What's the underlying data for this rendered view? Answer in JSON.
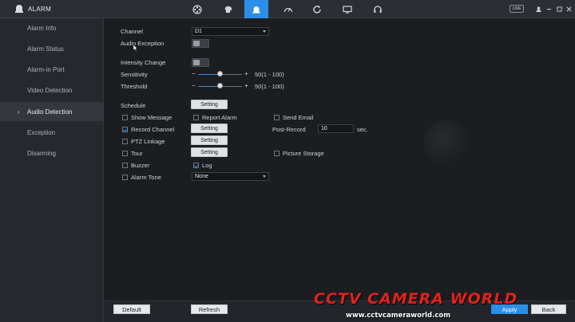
{
  "header": {
    "title": "ALARM",
    "live_label": "LIVE",
    "nav_icons": [
      "camera-icon",
      "brain-icon",
      "alarm-icon",
      "gauge-icon",
      "refresh-icon",
      "monitor-icon",
      "headset-icon"
    ],
    "active_icon": "alarm-icon"
  },
  "sidebar": {
    "items": [
      {
        "label": "Alarm Info"
      },
      {
        "label": "Alarm Status"
      },
      {
        "label": "Alarm-in Port"
      },
      {
        "label": "Video Detection"
      },
      {
        "label": "Audio Detection",
        "active": true
      },
      {
        "label": "Exception"
      },
      {
        "label": "Disarming"
      }
    ]
  },
  "form": {
    "channel_label": "Channel",
    "channel_value": "D1",
    "audio_exception_label": "Audio Exception",
    "intensity_change_label": "Intensity Change",
    "sensitivity_label": "Sensitivity",
    "sensitivity_value": "50(1 - 100)",
    "sensitivity_level": 50,
    "threshold_label": "Threshold",
    "threshold_value": "50(1 - 100)",
    "threshold_level": 50,
    "schedule_label": "Schedule",
    "setting_label": "Setting",
    "show_message_label": "Show Message",
    "report_alarm_label": "Report Alarm",
    "send_email_label": "Send Email",
    "record_channel_label": "Record Channel",
    "post_record_label": "Post-Record",
    "post_record_value": "10",
    "post_record_unit": "sec.",
    "ptz_linkage_label": "PTZ Linkage",
    "tour_label": "Tour",
    "picture_storage_label": "Picture Storage",
    "buzzer_label": "Buzzer",
    "log_label": "Log",
    "alarm_tone_label": "Alarm Tone",
    "alarm_tone_value": "None"
  },
  "footer": {
    "default_label": "Default",
    "refresh_label": "Refresh",
    "apply_label": "Apply",
    "back_label": "Back"
  },
  "watermark": {
    "title": "CCTV CAMERA WORLD",
    "url": "www.cctvcameraworld.com"
  },
  "colors": {
    "accent": "#2b8ee8",
    "watermark_red": "#e2231a"
  }
}
